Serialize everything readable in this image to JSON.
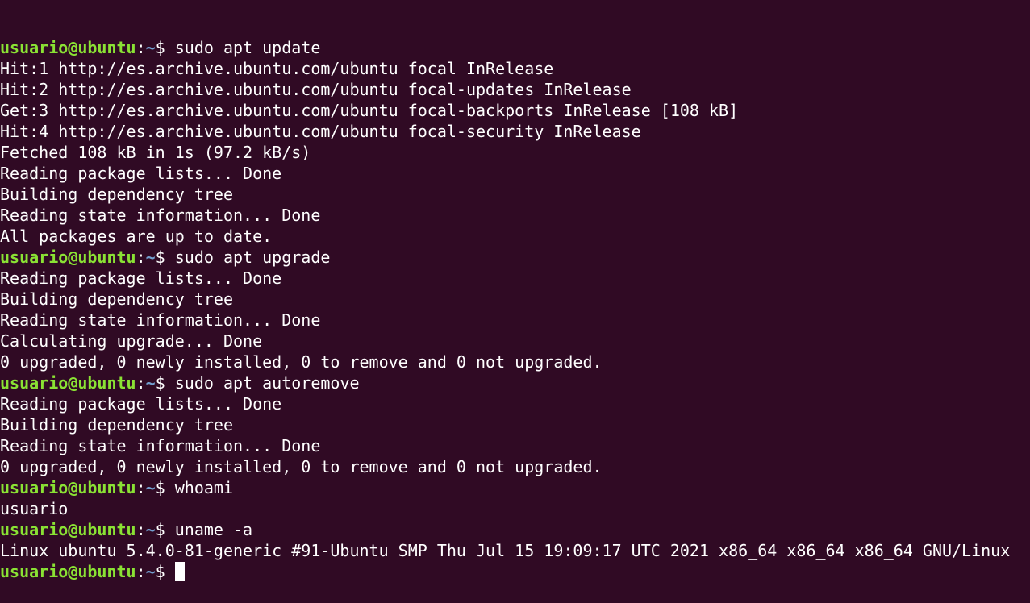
{
  "terminal": {
    "colors": {
      "background": "#300a24",
      "text": "#ffffff",
      "prompt_user": "#8ae234",
      "prompt_path": "#729fcf"
    },
    "prompt": {
      "user_host": "usuario@ubuntu",
      "separator": ":",
      "path": "~",
      "symbol": "$ "
    },
    "blocks": [
      {
        "command": "sudo apt update",
        "output": [
          "Hit:1 http://es.archive.ubuntu.com/ubuntu focal InRelease",
          "Hit:2 http://es.archive.ubuntu.com/ubuntu focal-updates InRelease",
          "Get:3 http://es.archive.ubuntu.com/ubuntu focal-backports InRelease [108 kB]",
          "Hit:4 http://es.archive.ubuntu.com/ubuntu focal-security InRelease",
          "Fetched 108 kB in 1s (97.2 kB/s)",
          "Reading package lists... Done",
          "Building dependency tree",
          "Reading state information... Done",
          "All packages are up to date."
        ]
      },
      {
        "command": "sudo apt upgrade",
        "output": [
          "Reading package lists... Done",
          "Building dependency tree",
          "Reading state information... Done",
          "Calculating upgrade... Done",
          "0 upgraded, 0 newly installed, 0 to remove and 0 not upgraded."
        ]
      },
      {
        "command": "sudo apt autoremove",
        "output": [
          "Reading package lists... Done",
          "Building dependency tree",
          "Reading state information... Done",
          "0 upgraded, 0 newly installed, 0 to remove and 0 not upgraded."
        ]
      },
      {
        "command": "whoami",
        "output": [
          "usuario"
        ]
      },
      {
        "command": "uname -a",
        "output": [
          "Linux ubuntu 5.4.0-81-generic #91-Ubuntu SMP Thu Jul 15 19:09:17 UTC 2021 x86_64 x86_64 x86_64 GNU/Linux"
        ]
      }
    ],
    "current_input": ""
  }
}
